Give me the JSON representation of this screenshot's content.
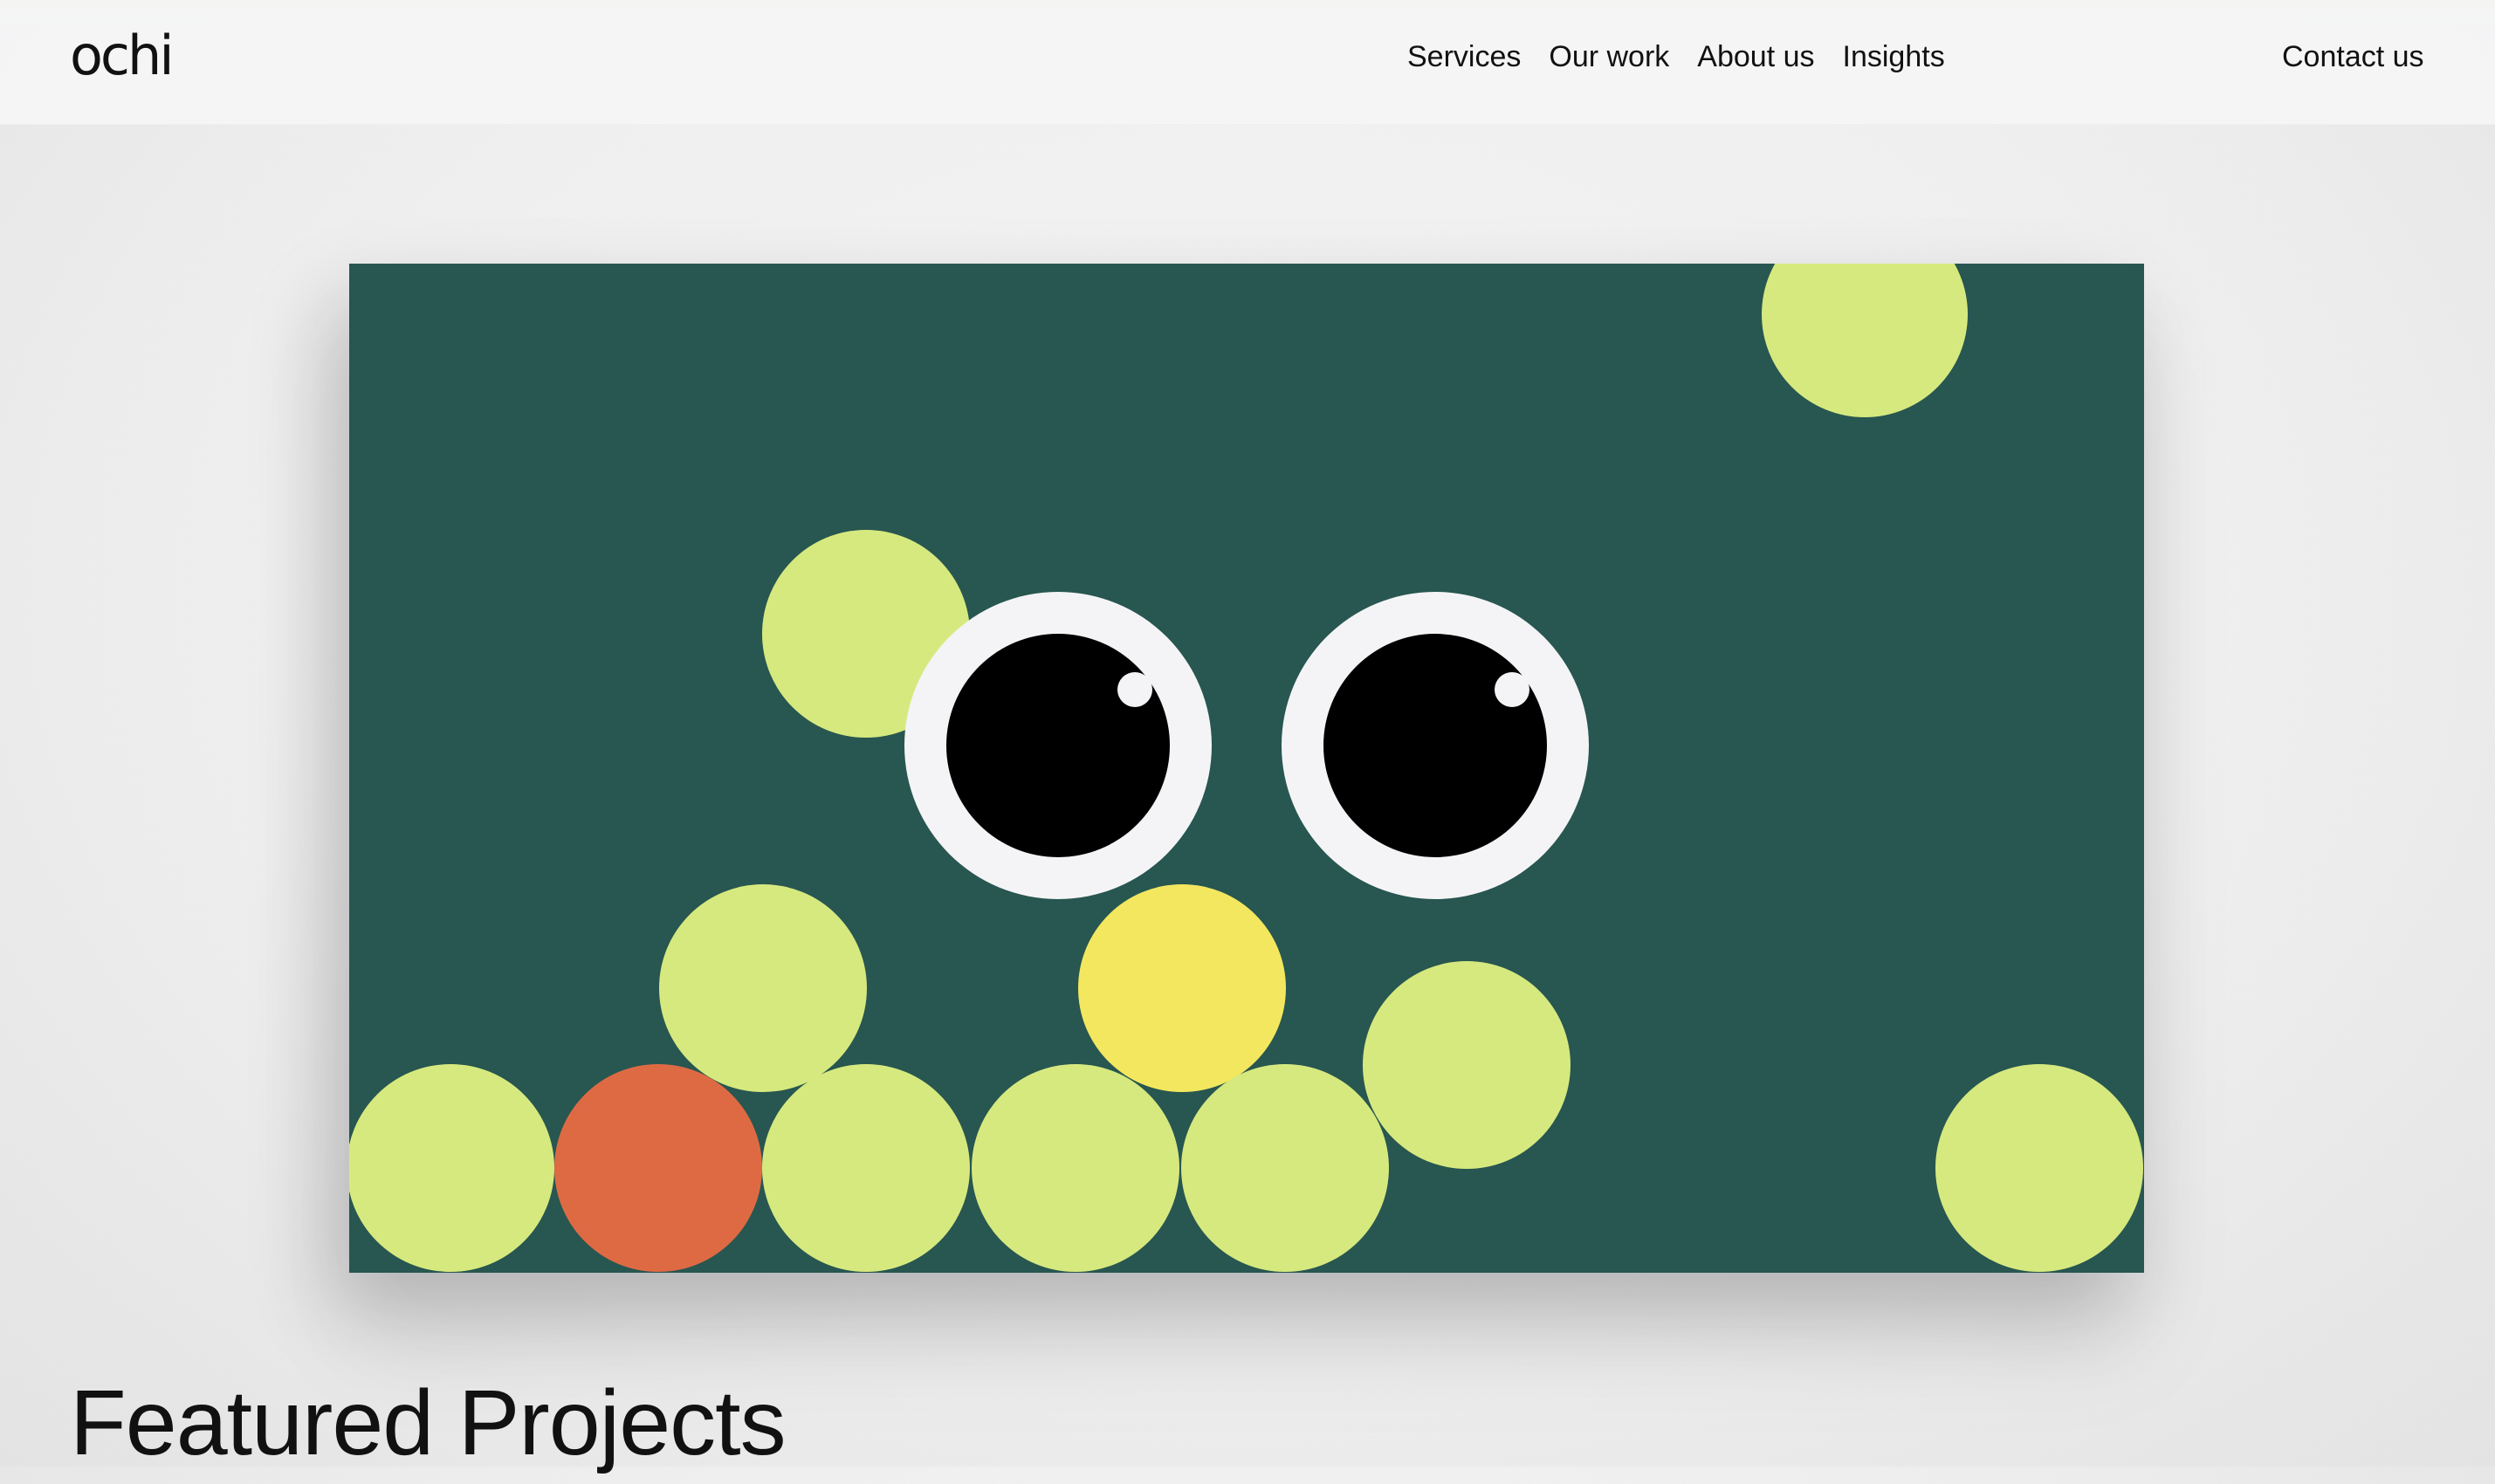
{
  "brand": {
    "logo_text": "ochi",
    "accent_color": "#d8eb8a"
  },
  "nav": {
    "links": [
      {
        "label": "Services"
      },
      {
        "label": "Our work"
      },
      {
        "label": "About us"
      },
      {
        "label": "Insights"
      }
    ],
    "contact_label": "Contact us"
  },
  "hero": {
    "background_color": "#285650",
    "ball_colors": {
      "lime": "#d6e97f",
      "yellow": "#f2e75f",
      "orange": "#de6a44"
    },
    "eye_color": "#f4f4f6",
    "pupil_color": "#000000",
    "icons": [
      "eye-icon",
      "eye-icon"
    ]
  },
  "sections": {
    "featured_title": "Featured Projects"
  }
}
